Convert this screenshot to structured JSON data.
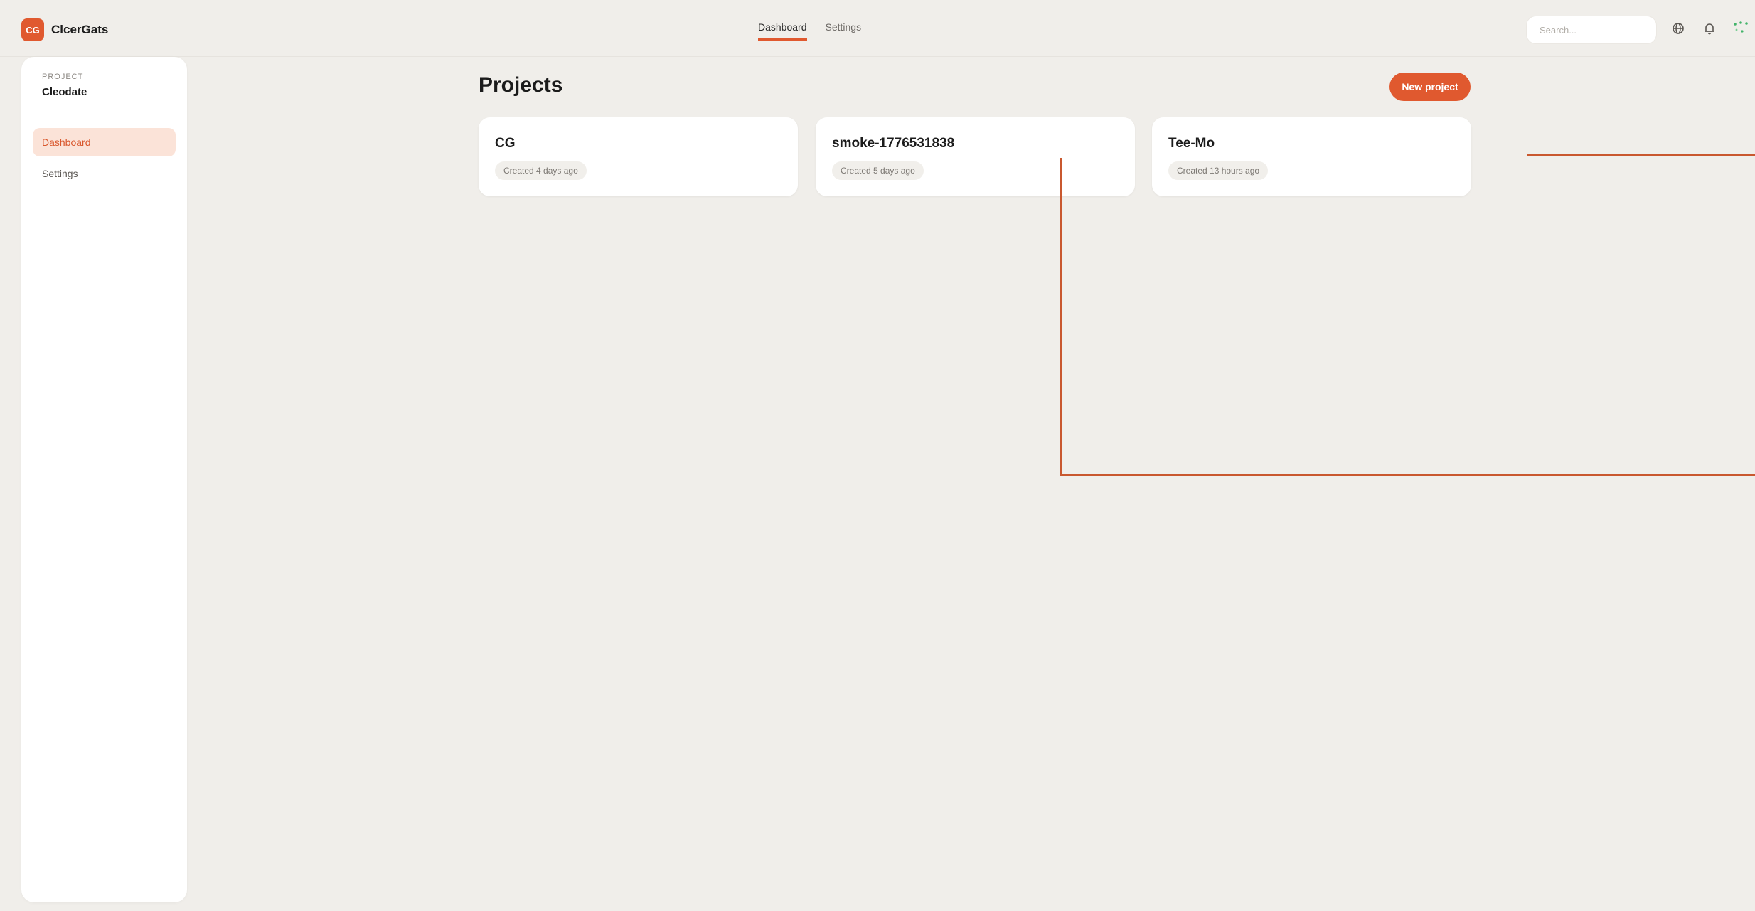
{
  "app": {
    "logo_text": "CG",
    "name": "ClcerGats"
  },
  "topnav": {
    "items": [
      {
        "label": "Dashboard",
        "active": true
      },
      {
        "label": "Settings",
        "active": false
      }
    ]
  },
  "search": {
    "placeholder": "Search..."
  },
  "header_icons": [
    "globe-icon",
    "bell-icon",
    "status-icon"
  ],
  "sidebar": {
    "kicker": "PROJECT",
    "project_name": "Cleodate",
    "items": [
      {
        "label": "Dashboard",
        "active": true
      },
      {
        "label": "Settings",
        "active": false
      }
    ]
  },
  "main": {
    "title": "Projects",
    "new_button": "New project",
    "projects": [
      {
        "name": "CG",
        "created": "Created 4 days ago"
      },
      {
        "name": "smoke-1776531838",
        "created": "Created 5 days ago"
      },
      {
        "name": "Tee-Mo",
        "created": "Created 13 hours ago"
      }
    ]
  },
  "colors": {
    "accent": "#e0592f",
    "accent_soft": "#fbe3d8",
    "background": "#f0eeea",
    "surface": "#ffffff",
    "connector": "#c9582f",
    "status_green": "#43b36a"
  }
}
